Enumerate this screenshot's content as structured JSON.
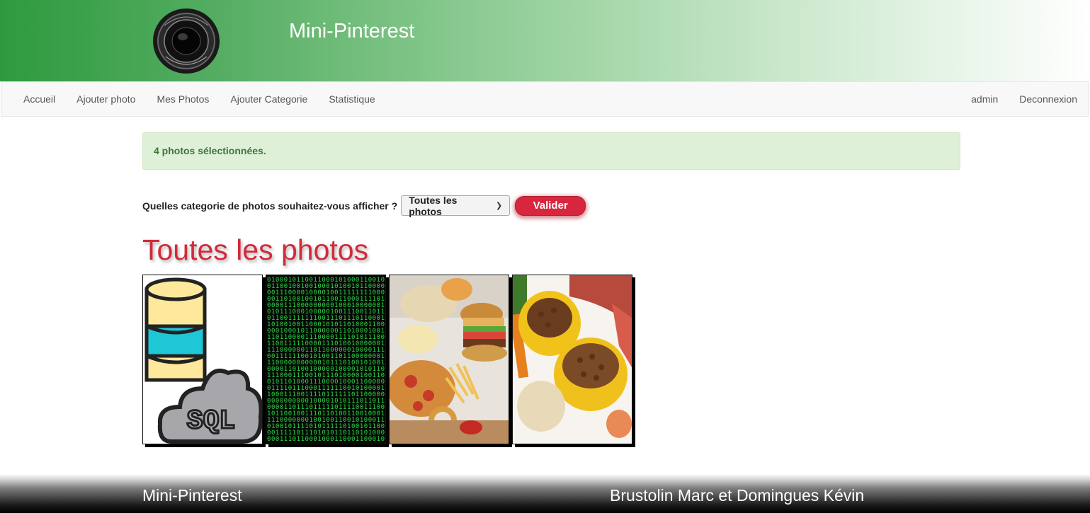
{
  "header": {
    "title": "Mini-Pinterest",
    "logo_icon": "camera-lens-icon"
  },
  "nav": {
    "left": [
      "Accueil",
      "Ajouter photo",
      "Mes Photos",
      "Ajouter Categorie",
      "Statistique"
    ],
    "right": [
      "admin",
      "Deconnexion"
    ]
  },
  "alert": {
    "text": "4 photos sélectionnées."
  },
  "filter": {
    "label": "Quelles categorie de photos souhaitez-vous afficher ?",
    "selected": "Toutes les photos",
    "submit_label": "Valider"
  },
  "section": {
    "title": "Toutes les photos"
  },
  "photos": [
    {
      "subject": "sql-database-icon"
    },
    {
      "subject": "binary-code-matrix"
    },
    {
      "subject": "fast-food"
    },
    {
      "subject": "pet-food-bowls"
    }
  ],
  "footer": {
    "left": "Mini-Pinterest",
    "right": "Brustolin Marc et Domingues Kévin"
  },
  "colors": {
    "header_green": "#2e9a3e",
    "accent_red": "#d22a3b",
    "alert_bg": "#dff0d8",
    "alert_text": "#3c763d"
  }
}
